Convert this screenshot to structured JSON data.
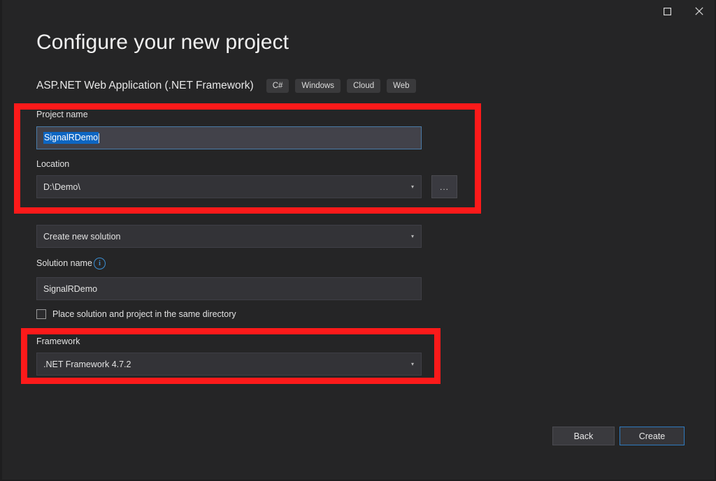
{
  "window": {
    "controls": [
      {
        "name": "maximize",
        "icon": "square-icon",
        "label": "Maximize"
      },
      {
        "name": "close",
        "icon": "close-icon",
        "label": "Close"
      }
    ]
  },
  "header": {
    "title": "Configure your new project",
    "template_name": "ASP.NET Web Application (.NET Framework)",
    "tags": [
      "C#",
      "Windows",
      "Cloud",
      "Web"
    ]
  },
  "form": {
    "project_name": {
      "label": "Project name",
      "value": "SignalRDemo"
    },
    "location": {
      "label": "Location",
      "value": "D:\\Demo\\",
      "browse_label": "...",
      "chevron": "▾"
    },
    "solution": {
      "value": "Create new solution",
      "chevron": "▾"
    },
    "solution_name": {
      "label": "Solution name",
      "info_glyph": "i",
      "value": "SignalRDemo"
    },
    "same_directory": {
      "label": "Place solution and project in the same directory",
      "checked": false
    },
    "framework": {
      "label": "Framework",
      "value": ".NET Framework 4.7.2",
      "chevron": "▾"
    }
  },
  "footer": {
    "back_label": "Back",
    "create_label": "Create"
  },
  "annotations": {
    "highlight_color": "#fc1a1a",
    "boxes": [
      {
        "name": "project-name-and-location-highlight"
      },
      {
        "name": "framework-highlight"
      }
    ]
  },
  "colors": {
    "background": "#252526",
    "input_background": "#333337",
    "focused_input_background": "#42424a",
    "selection_blue": "#0d66c2",
    "accent_blue": "#2e7bbf",
    "info_blue": "#3b8fd4"
  }
}
